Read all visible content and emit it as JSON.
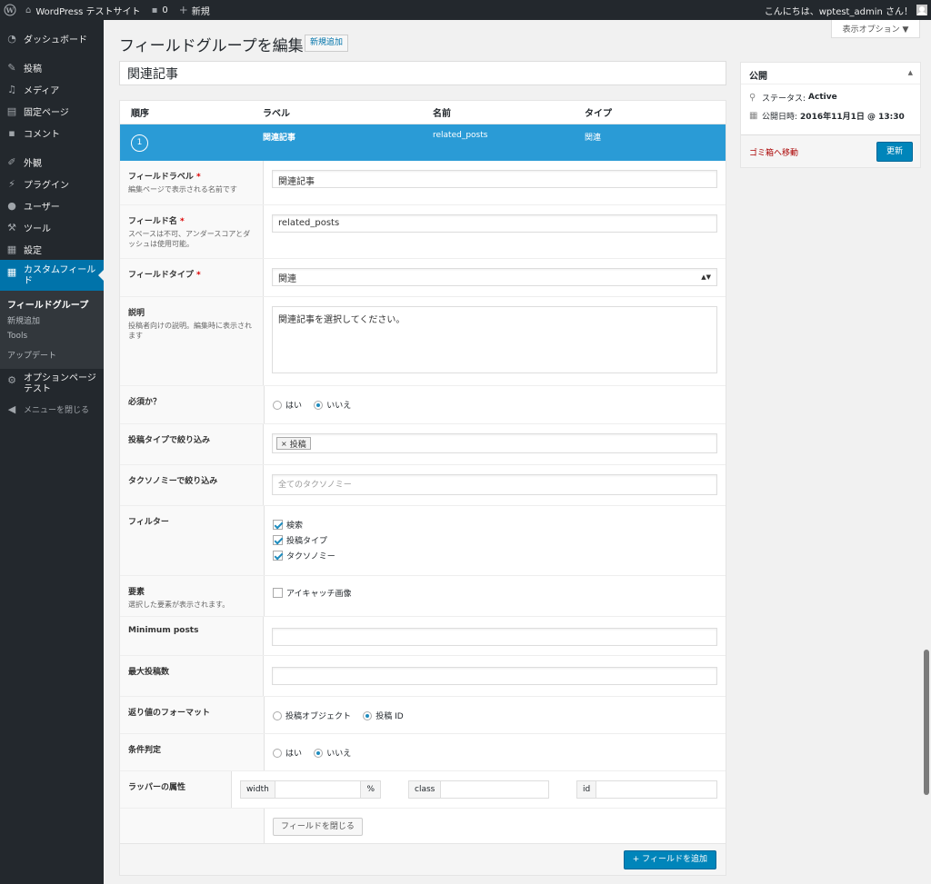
{
  "adminbar": {
    "site_name": "WordPress テストサイト",
    "comments_count": "0",
    "new_label": "新規",
    "greeting": "こんにちは、wptest_admin さん！"
  },
  "sidebar": {
    "items": [
      {
        "label": "ダッシュボード",
        "icon": "dashboard-icon"
      },
      {
        "label": "投稿",
        "icon": "pin-icon"
      },
      {
        "label": "メディア",
        "icon": "media-icon"
      },
      {
        "label": "固定ページ",
        "icon": "page-icon"
      },
      {
        "label": "コメント",
        "icon": "comment-icon"
      },
      {
        "label": "外観",
        "icon": "brush-icon"
      },
      {
        "label": "プラグイン",
        "icon": "plugin-icon"
      },
      {
        "label": "ユーザー",
        "icon": "user-icon"
      },
      {
        "label": "ツール",
        "icon": "wrench-icon"
      },
      {
        "label": "設定",
        "icon": "settings-icon"
      },
      {
        "label": "カスタムフィールド",
        "icon": "grid-icon"
      }
    ],
    "submenu": [
      "フィールドグループ",
      "新規追加",
      "Tools",
      "アップデート"
    ],
    "options_page": "オプションページテスト",
    "collapse": "メニューを閉じる"
  },
  "header": {
    "title": "フィールドグループを編集",
    "add_new": "新規追加",
    "screen_options": "表示オプション ▼"
  },
  "group_title": "関連記事",
  "field_table": {
    "columns": [
      "順序",
      "ラベル",
      "名前",
      "タイプ"
    ],
    "field": {
      "order": "1",
      "label": "関連記事",
      "name": "related_posts",
      "type": "関連"
    }
  },
  "settings": {
    "label": {
      "title": "フィールドラベル",
      "desc": "編集ページで表示される名前です",
      "value": "関連記事"
    },
    "name": {
      "title": "フィールド名",
      "desc": "スペースは不可、アンダースコアとダッシュは使用可能。",
      "value": "related_posts"
    },
    "type": {
      "title": "フィールドタイプ",
      "value": "関連"
    },
    "instructions": {
      "title": "説明",
      "desc": "投稿者向けの説明。編集時に表示されます",
      "value": "関連記事を選択してください。"
    },
    "required": {
      "title": "必須か？",
      "options": [
        "はい",
        "いいえ"
      ],
      "selected": "いいえ"
    },
    "post_type": {
      "title": "投稿タイプで絞り込み",
      "tag": "投稿"
    },
    "taxonomy": {
      "title": "タクソノミーで絞り込み",
      "placeholder": "全てのタクソノミー"
    },
    "filters": {
      "title": "フィルター",
      "options": [
        "検索",
        "投稿タイプ",
        "タクソノミー"
      ]
    },
    "elements": {
      "title": "要素",
      "desc": "選択した要素が表示されます。",
      "option": "アイキャッチ画像"
    },
    "min_posts": {
      "title": "Minimum posts"
    },
    "max_posts": {
      "title": "最大投稿数"
    },
    "return_format": {
      "title": "返り値のフォーマット",
      "options": [
        "投稿オブジェクト",
        "投稿 ID"
      ],
      "selected": "投稿 ID"
    },
    "conditional": {
      "title": "条件判定",
      "options": [
        "はい",
        "いいえ"
      ],
      "selected": "いいえ"
    },
    "wrapper": {
      "title": "ラッパーの属性",
      "width_label": "width",
      "width_suffix": "%",
      "class_label": "class",
      "id_label": "id"
    },
    "close_button": "フィールドを閉じる"
  },
  "add_field_button": "+ フィールドを追加",
  "publish": {
    "title": "公開",
    "status_label": "ステータス:",
    "status_value": "Active",
    "date_label": "公開日時:",
    "date_value": "2016年11月1日 @ 13:30",
    "trash": "ゴミ箱へ移動",
    "update": "更新"
  },
  "colors": {
    "accent": "#0073aa",
    "field_strip": "#2a9bd6",
    "sidebar": "#23282d"
  }
}
